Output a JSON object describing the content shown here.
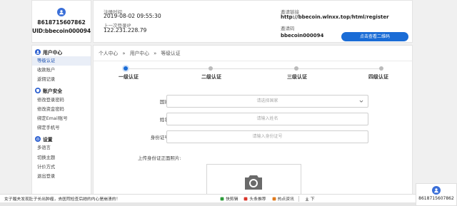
{
  "user": {
    "phone": "8618715607862",
    "uid": "UID:bbecoin000094"
  },
  "info": {
    "register_time_label": "注册时间",
    "register_time": "2019-08-02 09:55:30",
    "last_login_ip_label": "上一次登录IP",
    "last_login_ip": "122.231.228.79",
    "invite_link_label": "邀请链接",
    "invite_link": "http://bbecoin.wlnxx.top/html/register",
    "invite_code_label": "邀请码",
    "invite_code": "bbecoin000094",
    "qr_button": "点击查看二维码"
  },
  "sidebar": {
    "groups": [
      {
        "title": "用户中心",
        "icon": "user-icon",
        "items": [
          "等级认证",
          "收款账户",
          "返佣记录"
        ]
      },
      {
        "title": "账户安全",
        "icon": "shield-icon",
        "items": [
          "修改登录密码",
          "修改资金密码",
          "绑定Email账号",
          "绑定手机号"
        ]
      },
      {
        "title": "设置",
        "icon": "gear-icon",
        "items": [
          "多语言",
          "切换主题",
          "计价方式",
          "退出登录"
        ]
      }
    ]
  },
  "breadcrumb": [
    "个人中心",
    "»",
    "用户中心",
    "»",
    "等级认证"
  ],
  "steps": [
    "一级认证",
    "二级认证",
    "三级认证",
    "四级认证"
  ],
  "form": {
    "country_label": "国家:",
    "country_placeholder": "请选择国家",
    "name_label": "姓名:",
    "name_placeholder": "请输入姓名",
    "id_label": "身份证号:",
    "id_placeholder": "请输入身份证号",
    "upload_label": "上传身份证正面照片:"
  },
  "taskbar": {
    "news": "女子履夫发现肚子长出肿瘤，去医院检查后她的内心是崩溃的！",
    "items": [
      "快剪辑",
      "头条推荐",
      "热点资讯",
      "下"
    ]
  },
  "qr_card": {
    "text": "8618715607862"
  },
  "colors": {
    "accent": "#1a6cd6"
  }
}
